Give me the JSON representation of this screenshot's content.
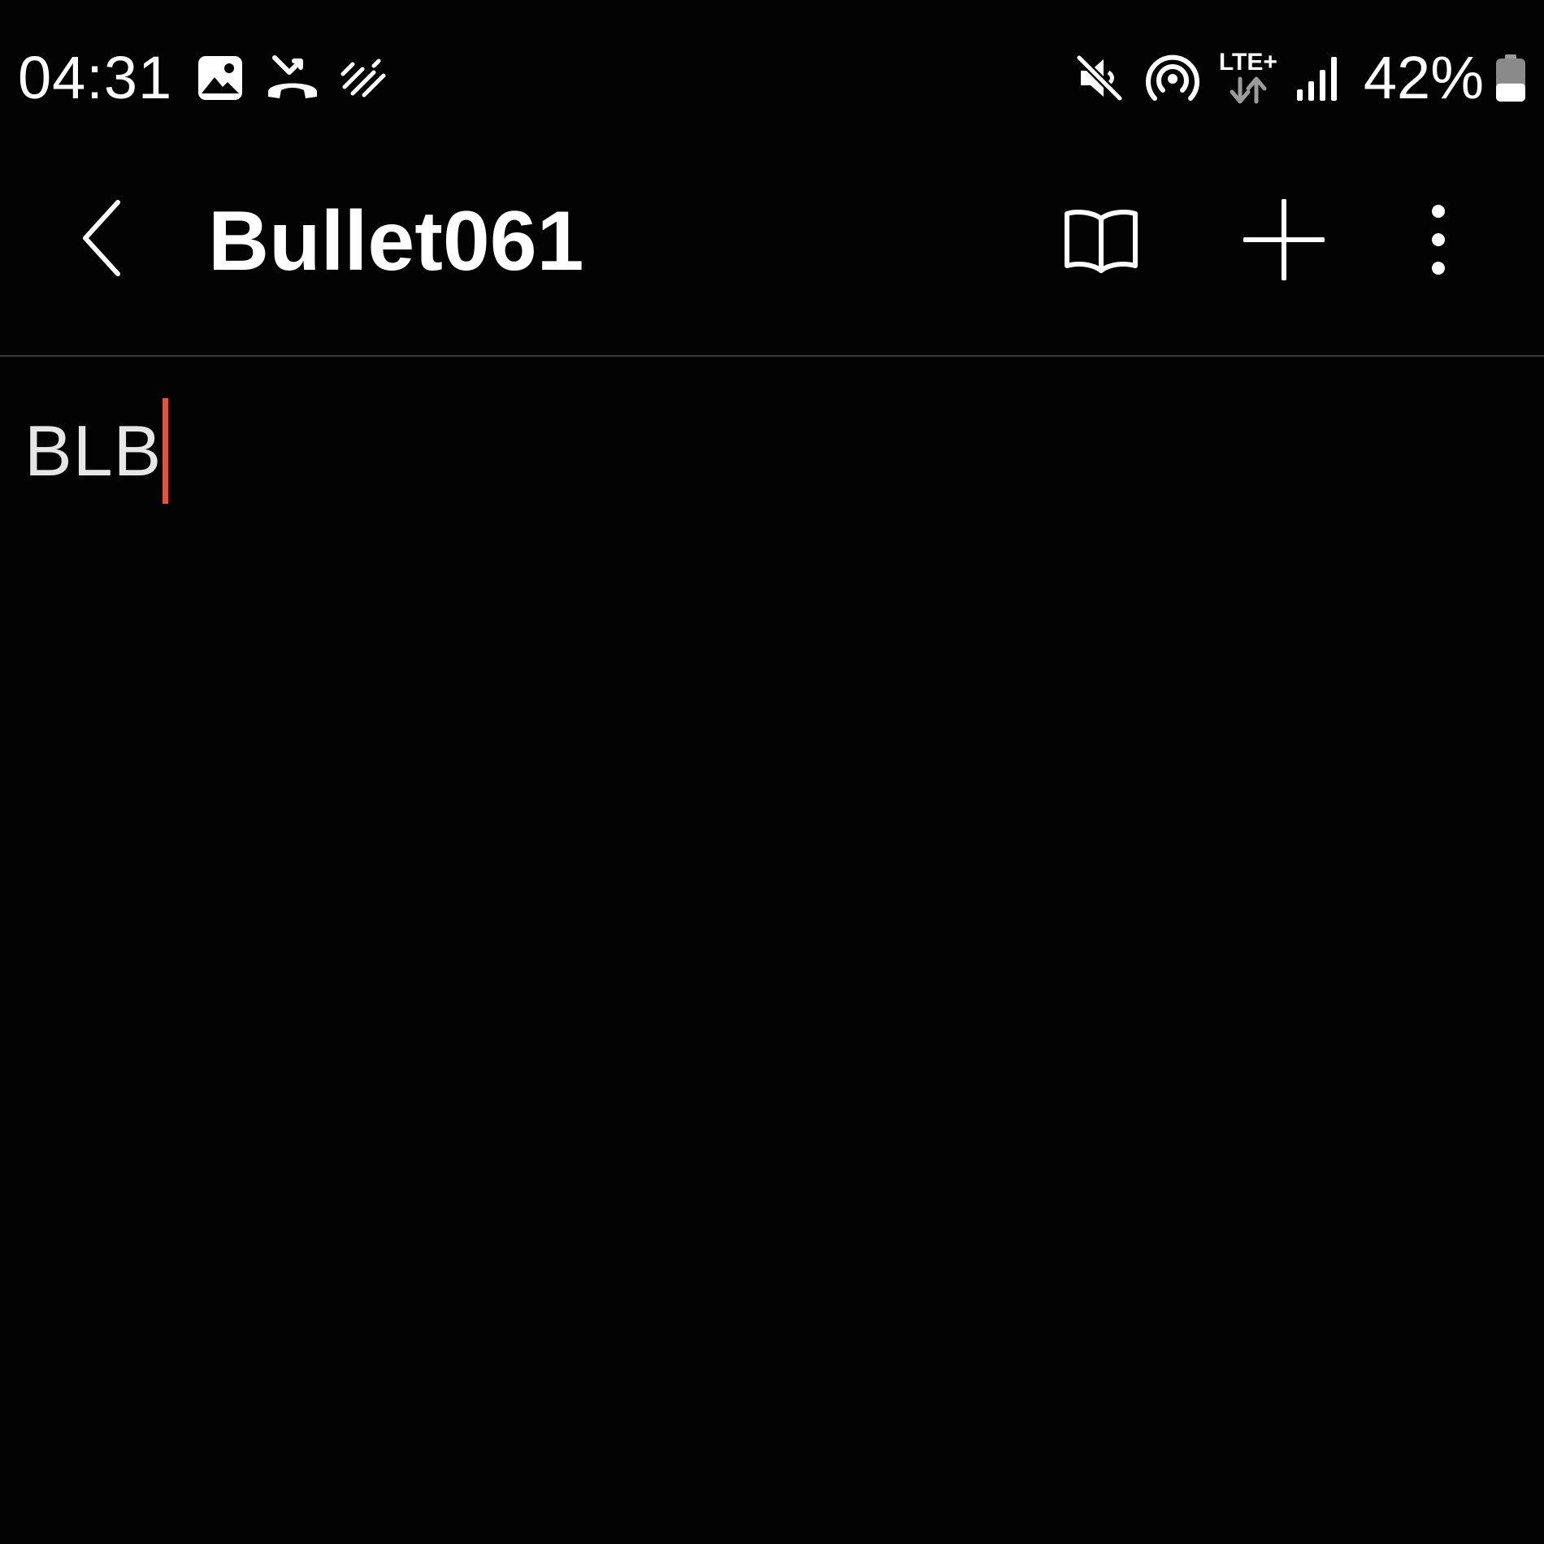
{
  "status_bar": {
    "time": "04:31",
    "left_icons": [
      "gallery-icon",
      "missed-call-icon",
      "data-saver-icon"
    ],
    "right_icons": [
      "mute-icon",
      "hotspot-icon",
      "lte-icon",
      "signal-icon",
      "battery-icon"
    ],
    "network_type": "LTE+",
    "battery_percent": "42%",
    "battery_level": 0.42
  },
  "app_bar": {
    "title": "Bullet061",
    "actions": [
      "back-icon",
      "reading-mode-icon",
      "add-icon",
      "more-options-icon"
    ]
  },
  "note": {
    "content": "BLB"
  },
  "colors": {
    "background": "#030303",
    "text_primary": "#ffffff",
    "text_body": "#e6e6e6",
    "cursor": "#e5533d",
    "divider": "#3a3a3a"
  }
}
